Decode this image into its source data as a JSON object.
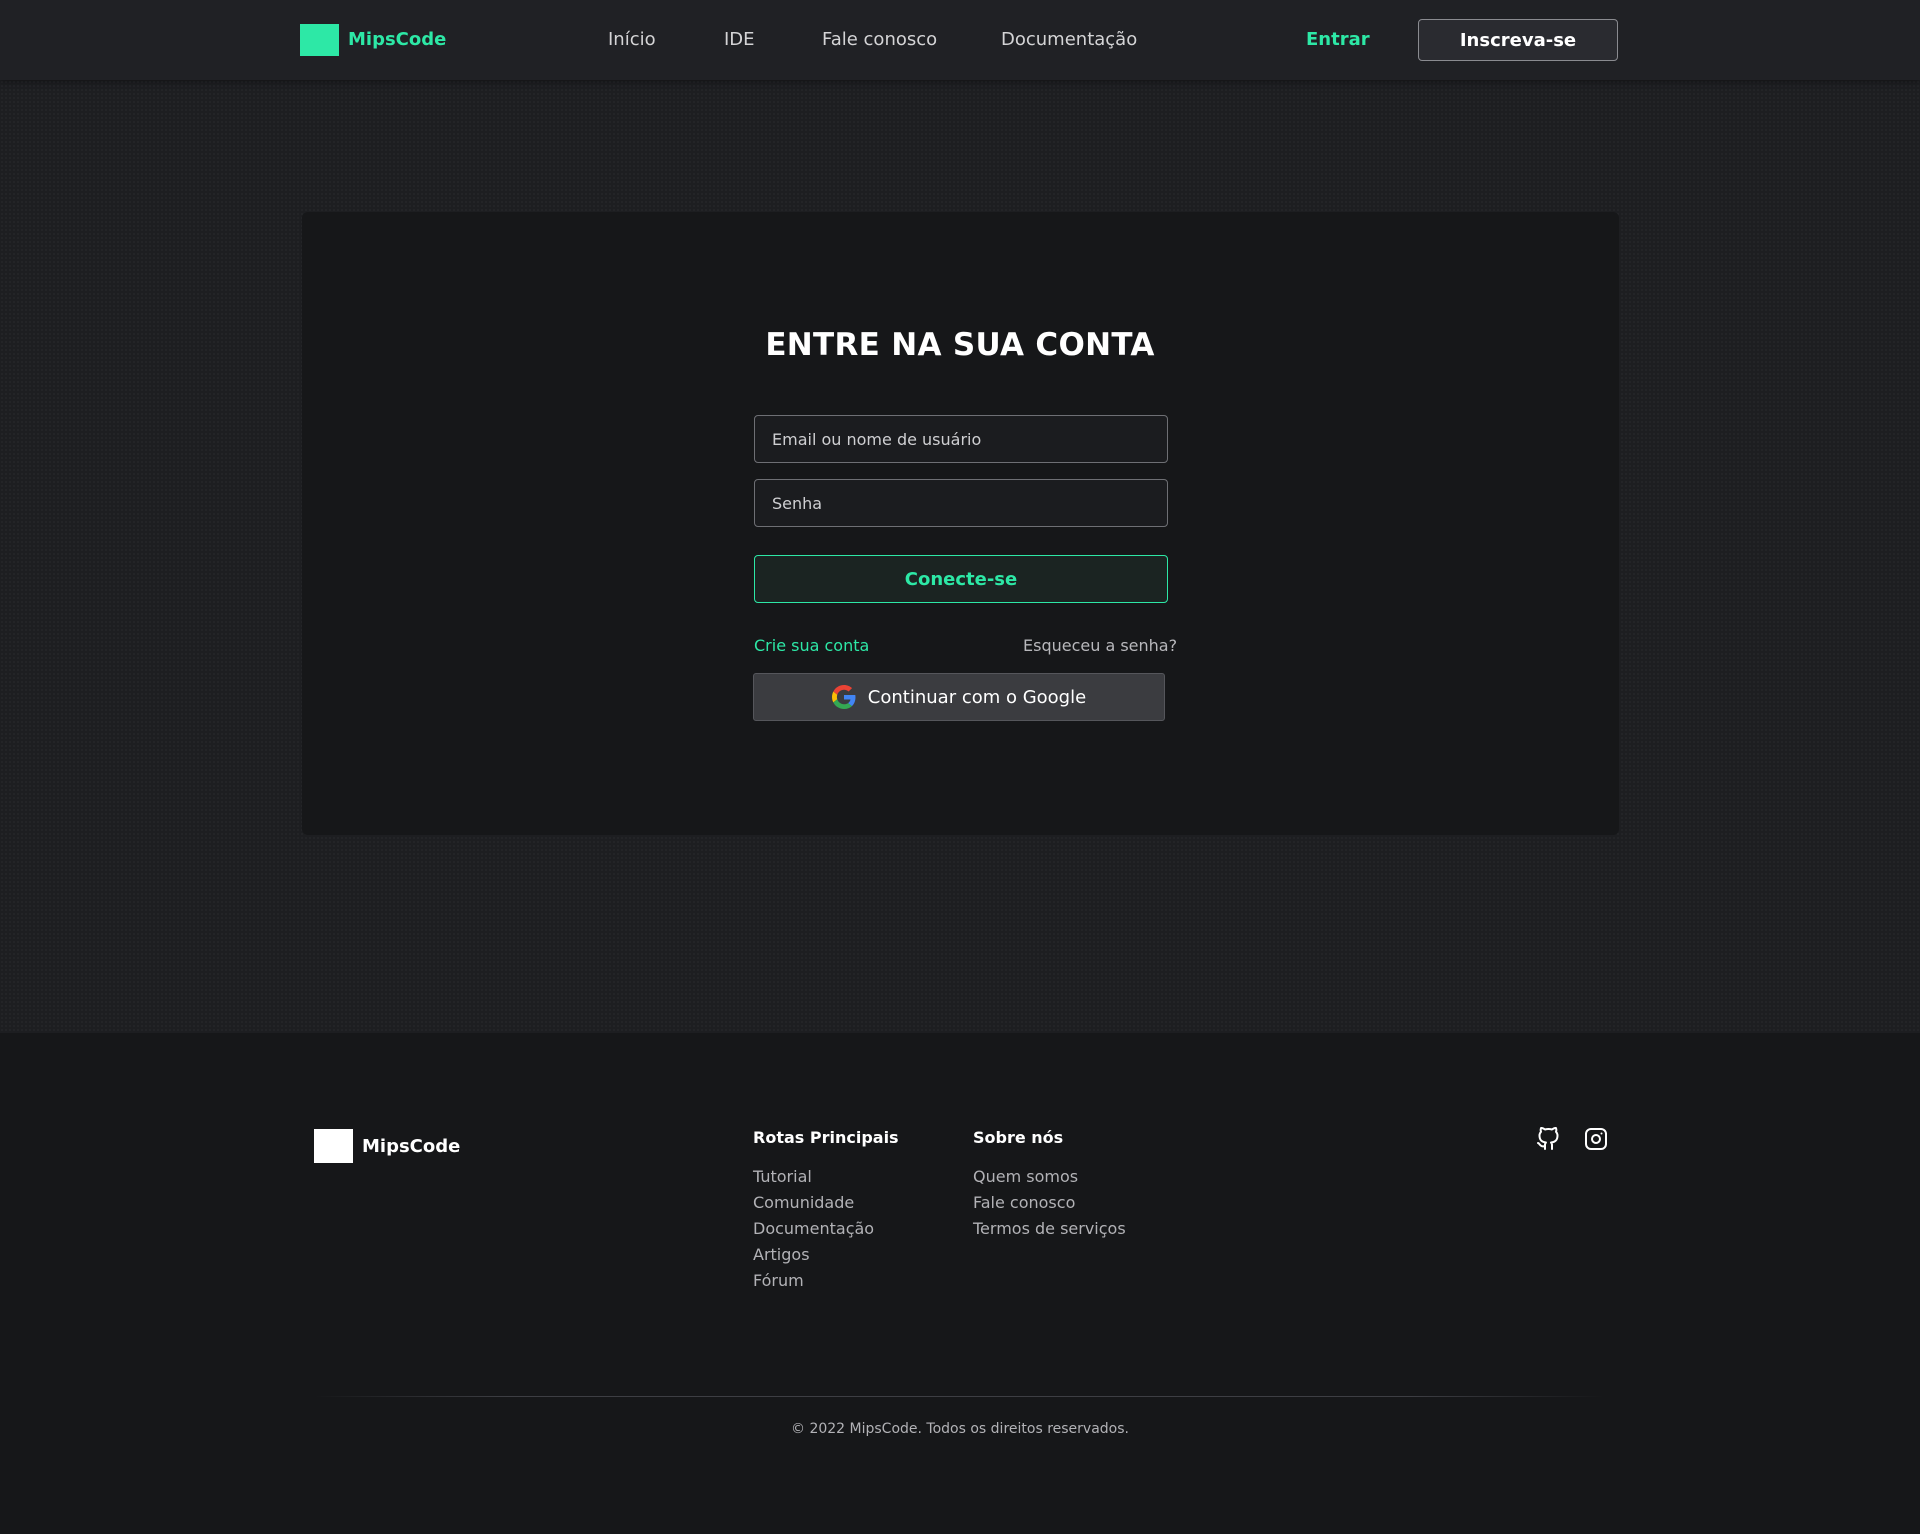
{
  "header": {
    "brand": "MipsCode",
    "nav": [
      "Início",
      "IDE",
      "Fale conosco",
      "Documentação"
    ],
    "login_link": "Entrar",
    "signup_button": "Inscreva-se"
  },
  "login": {
    "title": "ENTRE NA SUA CONTA",
    "email_placeholder": "Email ou nome de usuário",
    "password_placeholder": "Senha",
    "submit_label": "Conecte-se",
    "create_account": "Crie sua conta",
    "forgot_password": "Esqueceu a senha?",
    "google_button": "Continuar com o Google"
  },
  "footer": {
    "brand": "MipsCode",
    "columns": [
      {
        "title": "Rotas Principais",
        "links": [
          "Tutorial",
          "Comunidade",
          "Documentação",
          "Artigos",
          "Fórum"
        ]
      },
      {
        "title": "Sobre nós",
        "links": [
          "Quem somos",
          "Fale conosco",
          "Termos de serviços"
        ]
      }
    ],
    "social_icons": [
      "github-icon",
      "instagram-icon"
    ],
    "copyright": "© 2022 MipsCode. Todos os direitos reservados."
  },
  "colors": {
    "accent": "#2de8a6",
    "background": "#1d1e21",
    "card": "#161719",
    "footer": "#161719"
  }
}
